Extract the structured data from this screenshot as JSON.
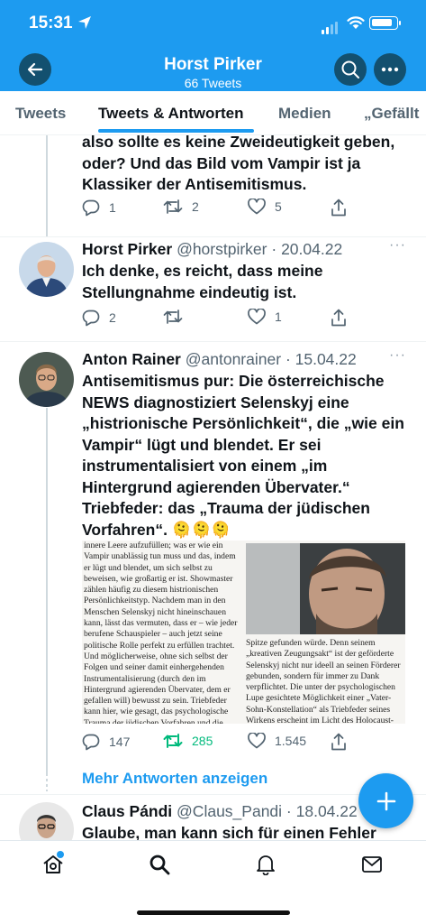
{
  "status_bar": {
    "time": "15:31"
  },
  "header": {
    "title": "Horst Pirker",
    "subtitle": "66 Tweets"
  },
  "tabs": [
    {
      "label": "Tweets",
      "active": false
    },
    {
      "label": "Tweets & Antworten",
      "active": true
    },
    {
      "label": "Medien",
      "active": false
    },
    {
      "label": "„Gefällt",
      "active": false
    }
  ],
  "tweets": [
    {
      "text": "also sollte es keine Zweideutigkeit geben, oder? Und das Bild vom Vampir ist ja Klassiker der Antisemitismus.",
      "replies": "1",
      "retweets": "2",
      "likes": "5"
    },
    {
      "name": "Horst Pirker",
      "handle": "@horstpirker",
      "date": "· 20.04.22",
      "text": "Ich denke, es reicht, dass meine Stellungnahme eindeutig ist.",
      "replies": "2",
      "retweets": "",
      "likes": "1"
    },
    {
      "name": "Anton Rainer",
      "handle": "@antonrainer",
      "date": "· 15.04.22",
      "text": "Antisemitismus pur: Die österreichische NEWS diagnostiziert Selenskyj eine „histrionische Persönlichkeit“, die „wie ein Vampir“ lügt und blendet. Er sei instrumentalisiert von einem „im Hintergrund agierenden Übervater.“ Triebfeder: das „Trauma der jüdischen Vorfahren“. 🫠🫠🫠",
      "replies": "147",
      "retweets": "285",
      "likes": "1.545",
      "article_left": "innere Leere aufzufüllen; was er wie ein Vampir unablässig tun muss und das, indem er lügt und blendet, um sich selbst zu beweisen, wie großartig er ist. Showmaster zählen häufig zu diesem histrionischen Persönlichkeitstyp. Nachdem man in den Menschen Selenskyj nicht hineinschauen kann, lässt das vermuten, dass er – wie jeder berufene Schauspieler – auch jetzt seine politische Rolle perfekt zu erfüllen trachtet. Und möglicherweise, ohne sich selbst der Folgen und seiner damit einhergehenden Instrumentalisierung (durch den im Hintergrund agierenden Übervater, dem er gefallen will) bewusst zu sein. Triebfeder kann hier, wie gesagt, das psychologische Trauma der jüdischen Vorfahren und die Sehnsucht nach dem Einssein und Geliebtwerden mit und von einem",
      "article_right": "Spitze gefunden würde. Denn seinem „kreativen Zeugungsakt“ ist der geförderte Selenskyj nicht nur ideell an seinen Förderer gebunden, sondern für immer zu Dank verpflichtet. Die unter der psychologischen Lupe gesichtete Möglichkeit einer „Vater-Sohn-Konstellation“ als Triebfeder seines Wirkens erscheint im Licht des Holocaust-Traumas der väterlichen Ahnen durchaus plausibel. Es kann sich bei Men"
    },
    {
      "name": "Claus Pándi",
      "handle": "@Claus_Pandi",
      "date": "· 18.04.22",
      "text": "Glaube, man kann sich für einen Fehler"
    }
  ],
  "more_answers_label": "Mehr Antworten anzeigen",
  "colors": {
    "accent": "#1d9bf0",
    "retweet_active": "#00ba7c",
    "muted": "#536471"
  }
}
